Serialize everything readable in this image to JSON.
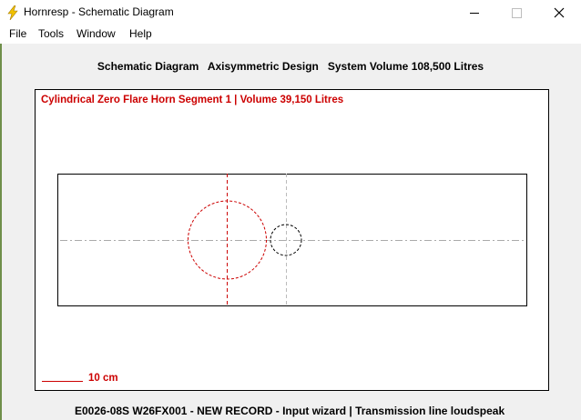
{
  "window": {
    "title": "Hornresp - Schematic Diagram",
    "app_icon": "lightning-bolt-icon",
    "controls": [
      "minimize-icon",
      "maximize-icon",
      "close-icon"
    ]
  },
  "menu": {
    "items": [
      {
        "label": "File"
      },
      {
        "label": "Tools"
      },
      {
        "label": "Window"
      },
      {
        "label": "Help"
      }
    ]
  },
  "header": {
    "text": "Schematic Diagram   Axisymmetric Design   System Volume 108,500 Litres"
  },
  "diagram": {
    "segment_title": "Cylindrical Zero Flare Horn Segment 1 | Volume 39,150 Litres",
    "scale_label": "10 cm",
    "colors": {
      "accent": "#cc0000",
      "outline": "#000000",
      "guide": "#aaaaaa"
    }
  },
  "status": {
    "text": "E0026-08S W26FX001 - NEW RECORD - Input wizard | Transmission line loudspeak"
  }
}
